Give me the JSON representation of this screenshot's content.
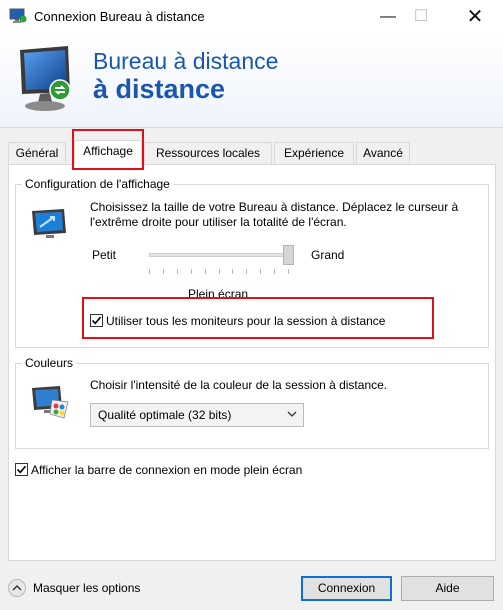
{
  "window": {
    "title": "Connexion Bureau à distance",
    "controls": {
      "minimize": "—",
      "maximize": "☐",
      "close": "✕"
    }
  },
  "banner": {
    "line1": "Bureau à distance",
    "line2": "à distance"
  },
  "tabs": [
    {
      "label": "Général",
      "active": false
    },
    {
      "label": "Affichage",
      "active": true
    },
    {
      "label": "Ressources locales",
      "active": false
    },
    {
      "label": "Expérience",
      "active": false
    },
    {
      "label": "Avancé",
      "active": false
    }
  ],
  "display_group": {
    "title": "Configuration de l'affichage",
    "description": "Choisissez la taille de votre Bureau à distance. Déplacez le curseur à l'extrême droite pour utiliser la totalité de l'écran.",
    "slider": {
      "min_label": "Petit",
      "max_label": "Grand",
      "value_label": "Plein écran",
      "position_fraction": 1.0
    },
    "use_all_monitors": {
      "label": "Utiliser tous les moniteurs pour la session à distance",
      "checked": true
    }
  },
  "colors_group": {
    "title": "Couleurs",
    "description": "Choisir l'intensité de la couleur de la session à distance.",
    "select_value": "Qualité optimale (32 bits)"
  },
  "connection_bar": {
    "label": "Afficher la barre de connexion en mode plein écran",
    "checked": true
  },
  "footer": {
    "options_toggle": "Masquer les options",
    "connect_button": "Connexion",
    "help_button": "Aide"
  },
  "colors": {
    "banner_text": "#1a56b0",
    "highlight": "#e0101a",
    "default_button_border": "#0f6fd5"
  }
}
